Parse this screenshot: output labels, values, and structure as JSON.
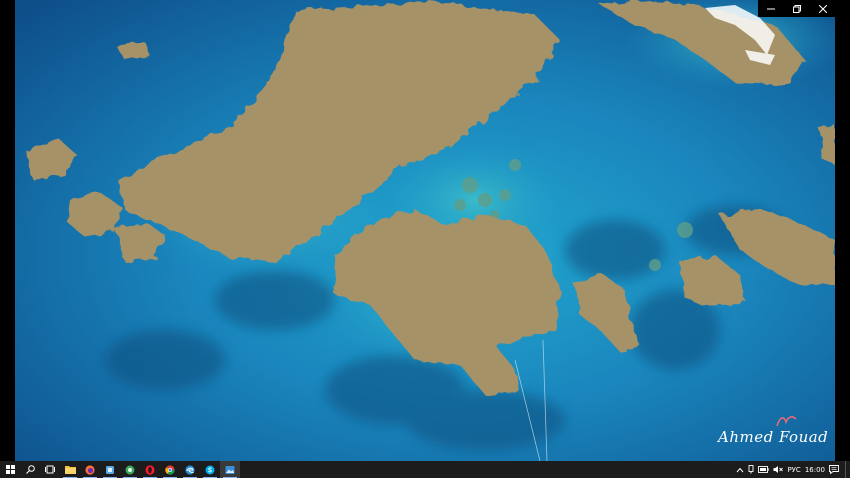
{
  "window": {
    "controls": {
      "minimize": "—",
      "maximize": "⧉",
      "close": "✕"
    }
  },
  "photo": {
    "subject": "aerial-coral-reef",
    "watermark": "Ahmed Fouad"
  },
  "taskbar": {
    "apps": [
      {
        "name": "start",
        "icon": "windows-logo-icon"
      },
      {
        "name": "search",
        "icon": "search-icon"
      },
      {
        "name": "task-view",
        "icon": "task-view-icon"
      },
      {
        "name": "file-explorer",
        "icon": "folder-icon"
      },
      {
        "name": "firefox",
        "icon": "firefox-icon"
      },
      {
        "name": "app-blue",
        "icon": "app-icon"
      },
      {
        "name": "app-green",
        "icon": "app-icon"
      },
      {
        "name": "opera",
        "icon": "opera-icon"
      },
      {
        "name": "chrome",
        "icon": "chrome-icon"
      },
      {
        "name": "edge",
        "icon": "edge-icon"
      },
      {
        "name": "skype",
        "icon": "skype-icon"
      },
      {
        "name": "photos",
        "icon": "photos-icon"
      }
    ],
    "tray": {
      "language": "РУС",
      "time": "16:00"
    }
  },
  "colors": {
    "taskbar": "#1c1c1c",
    "water_deep": "#0f5e9e",
    "water_shallow": "#1f9cc8",
    "reef": "#a89263",
    "accent": "#8ab4f8"
  }
}
